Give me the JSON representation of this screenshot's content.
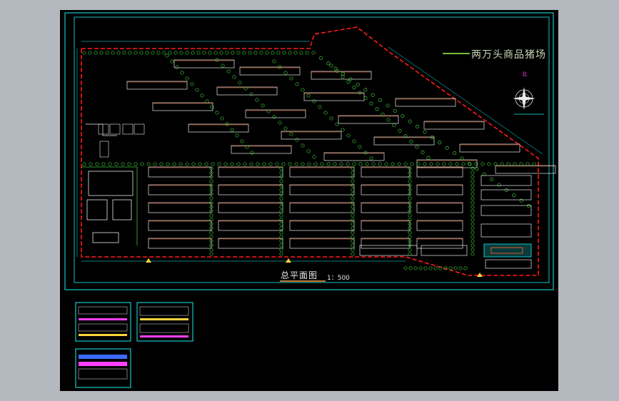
{
  "drawing": {
    "title": "两万头商品猪场",
    "north_label": "北",
    "plan_title": "总平面图",
    "plan_scale": "1：500"
  },
  "colors": {
    "background": "#000000",
    "frame": "#19f0f0",
    "boundary": "#ff1a1a",
    "trees": "#3cc43c",
    "buildings": "#e8e8e8",
    "roof_strip": "#ff6a2a",
    "title_text": "#c7d6b5",
    "page_bg": "#b4b8bf"
  },
  "icons": {
    "north_arrow": "compass-icon",
    "tree": "tree-icon"
  },
  "sheets": [
    {
      "name": "elevation-sheet-1"
    },
    {
      "name": "elevation-sheet-2"
    },
    {
      "name": "section-sheet-3"
    }
  ]
}
